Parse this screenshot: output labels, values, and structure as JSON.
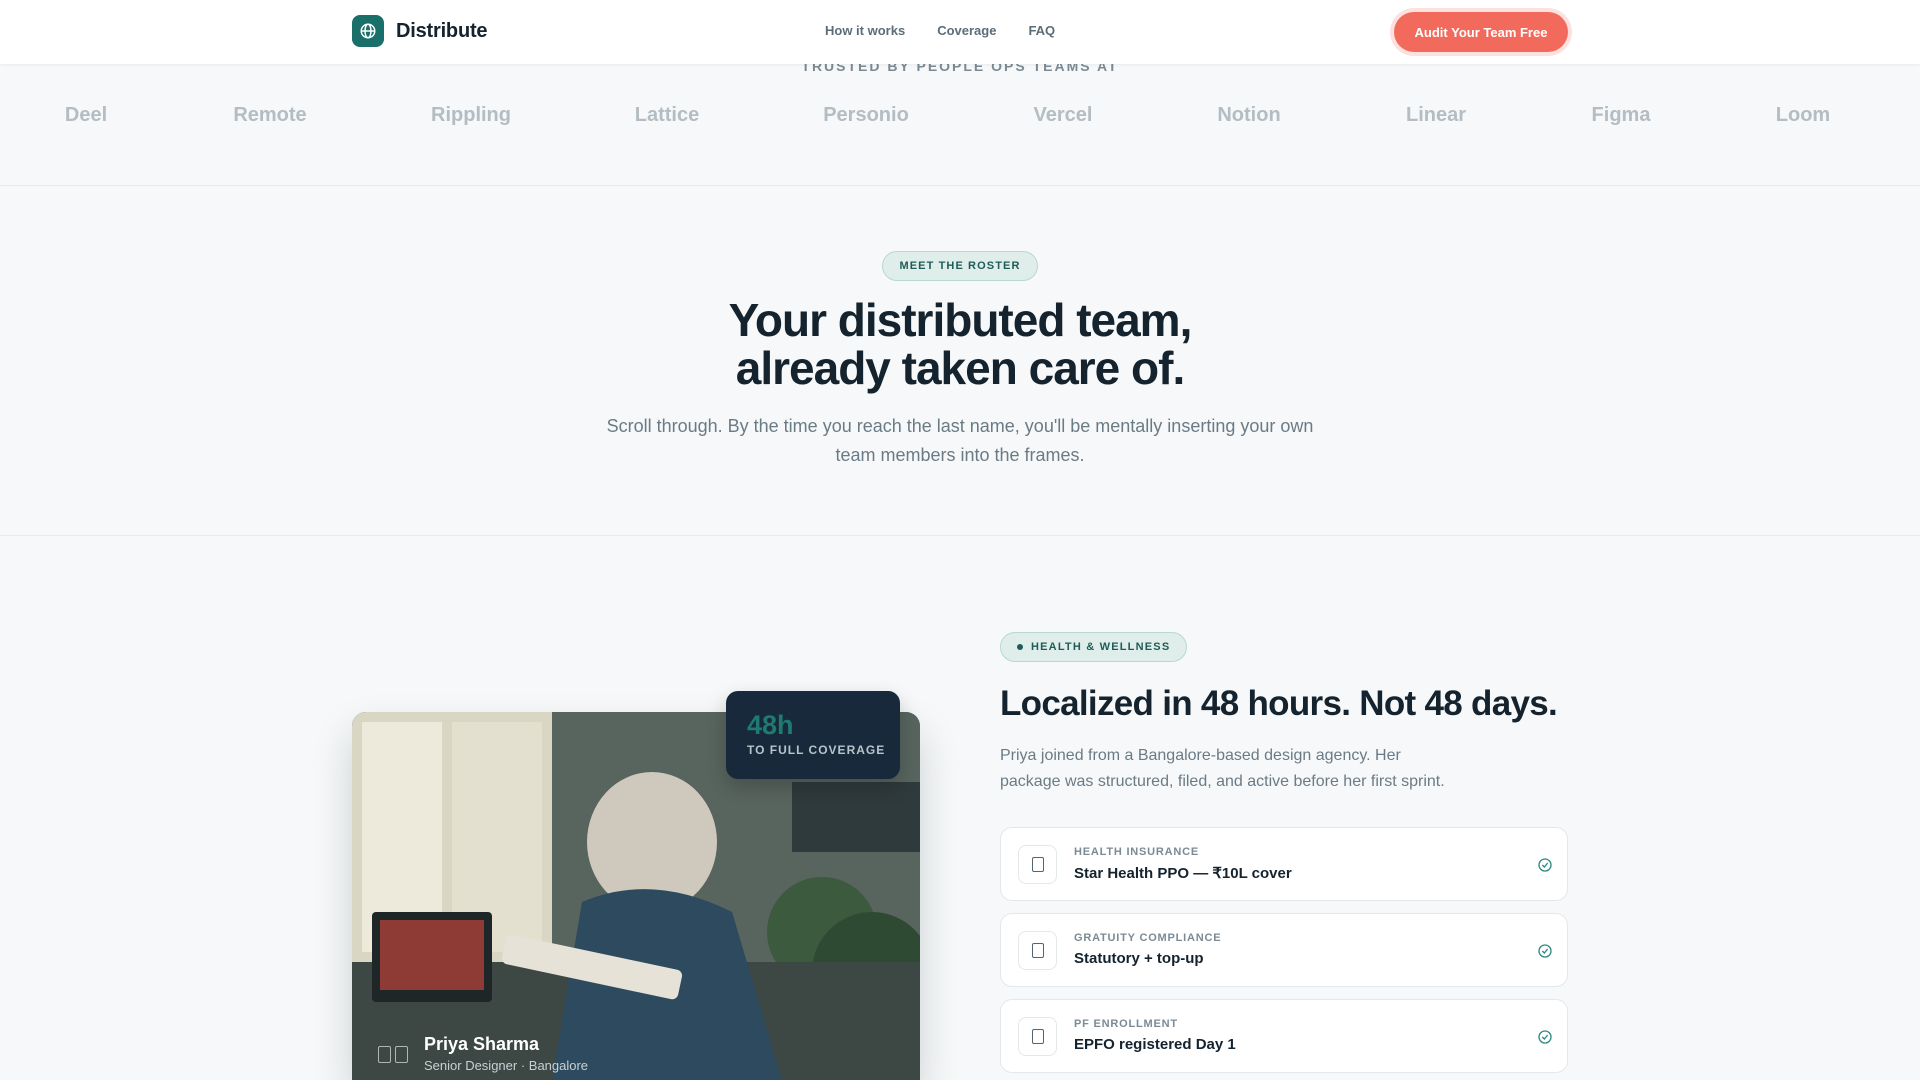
{
  "header": {
    "brand_name": "Distribute",
    "nav": [
      "How it works",
      "Coverage",
      "FAQ"
    ],
    "cta_label": "Audit Your Team Free"
  },
  "trusted": {
    "label": "TRUSTED BY PEOPLE OPS TEAMS AT",
    "logos": [
      "Deel",
      "Remote",
      "Rippling",
      "Lattice",
      "Personio",
      "Vercel",
      "Notion",
      "Linear",
      "Figma",
      "Loom"
    ]
  },
  "roster": {
    "pill": "MEET THE ROSTER",
    "title_line1": "Your distributed team,",
    "title_line2": "already taken care of.",
    "subtitle": "Scroll through. By the time you reach the last name, you'll be mentally inserting your own team members into the frames."
  },
  "feature": {
    "badge_value": "48h",
    "badge_label": "TO FULL COVERAGE",
    "person_name": "Priya Sharma",
    "person_role": "Senior Designer · Bangalore",
    "pill": "HEALTH & WELLNESS",
    "title": "Localized in 48 hours. Not 48 days.",
    "description": "Priya joined from a Bangalore-based design agency. Her package was structured, filed, and active before her first sprint.",
    "items": [
      {
        "label": "HEALTH INSURANCE",
        "value": "Star Health PPO — ₹10L cover",
        "icon": "document-icon"
      },
      {
        "label": "GRATUITY COMPLIANCE",
        "value": "Statutory + top-up",
        "icon": "document-icon"
      },
      {
        "label": "PF ENROLLMENT",
        "value": "EPFO registered Day 1",
        "icon": "document-icon"
      }
    ]
  },
  "colors": {
    "brand": "#1b6f6a",
    "cta": "#f26a5c",
    "ink": "#14232e",
    "badge_bg": "#17293a"
  }
}
